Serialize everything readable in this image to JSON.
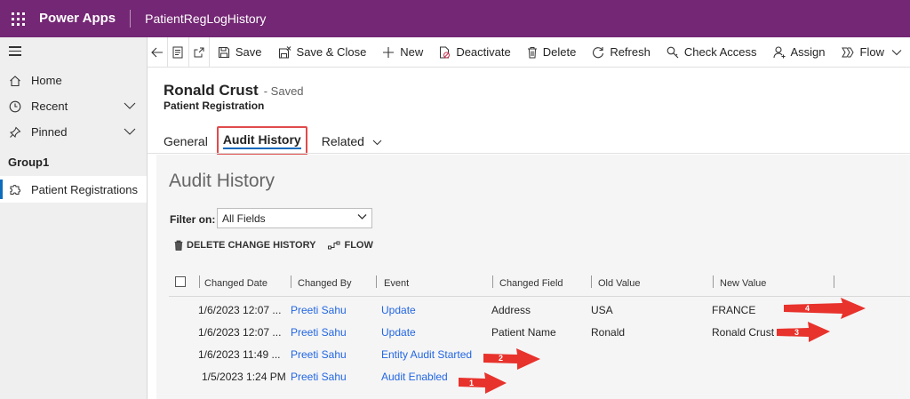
{
  "topbar": {
    "app_name": "Power Apps",
    "page_name": "PatientRegLogHistory"
  },
  "sidebar": {
    "items": [
      {
        "label": "Home",
        "icon": "home-icon"
      },
      {
        "label": "Recent",
        "icon": "clock-icon"
      },
      {
        "label": "Pinned",
        "icon": "pin-icon"
      }
    ],
    "group_label": "Group1",
    "active_item": {
      "label": "Patient Registrations",
      "icon": "puzzle-icon"
    }
  },
  "commandbar": {
    "save": "Save",
    "save_close": "Save & Close",
    "new": "New",
    "deactivate": "Deactivate",
    "delete": "Delete",
    "refresh": "Refresh",
    "check_access": "Check Access",
    "assign": "Assign",
    "flow": "Flow"
  },
  "record": {
    "title": "Ronald Crust",
    "status": "- Saved",
    "entity": "Patient Registration"
  },
  "tabs": {
    "general": "General",
    "audit": "Audit History",
    "related": "Related"
  },
  "audit": {
    "title": "Audit History",
    "filter_label": "Filter on:",
    "filter_value": "All Fields",
    "delete_history": "DELETE CHANGE HISTORY",
    "flow": "FLOW",
    "columns": [
      "Changed Date",
      "Changed By",
      "Event",
      "Changed Field",
      "Old Value",
      "New Value"
    ],
    "rows": [
      {
        "date": "1/6/2023 12:07 ...",
        "by": "Preeti Sahu",
        "event": "Update",
        "field": "Address",
        "old": "USA",
        "new": "FRANCE"
      },
      {
        "date": "1/6/2023 12:07 ...",
        "by": "Preeti Sahu",
        "event": "Update",
        "field": "Patient Name",
        "old": "Ronald",
        "new": "Ronald Crust"
      },
      {
        "date": "1/6/2023 11:49 ...",
        "by": "Preeti Sahu",
        "event": "Entity Audit Started",
        "field": "",
        "old": "",
        "new": ""
      },
      {
        "date": "1/5/2023 1:24 PM",
        "by": "Preeti Sahu",
        "event": "Audit Enabled",
        "field": "",
        "old": "",
        "new": ""
      }
    ]
  },
  "annotations": [
    "4",
    "3",
    "2",
    "1"
  ],
  "colors": {
    "topbar": "#742774",
    "accent": "#0f6cbd",
    "link": "#2266e3",
    "highlight": "#e04b4b",
    "arrow": "#e8322c"
  }
}
